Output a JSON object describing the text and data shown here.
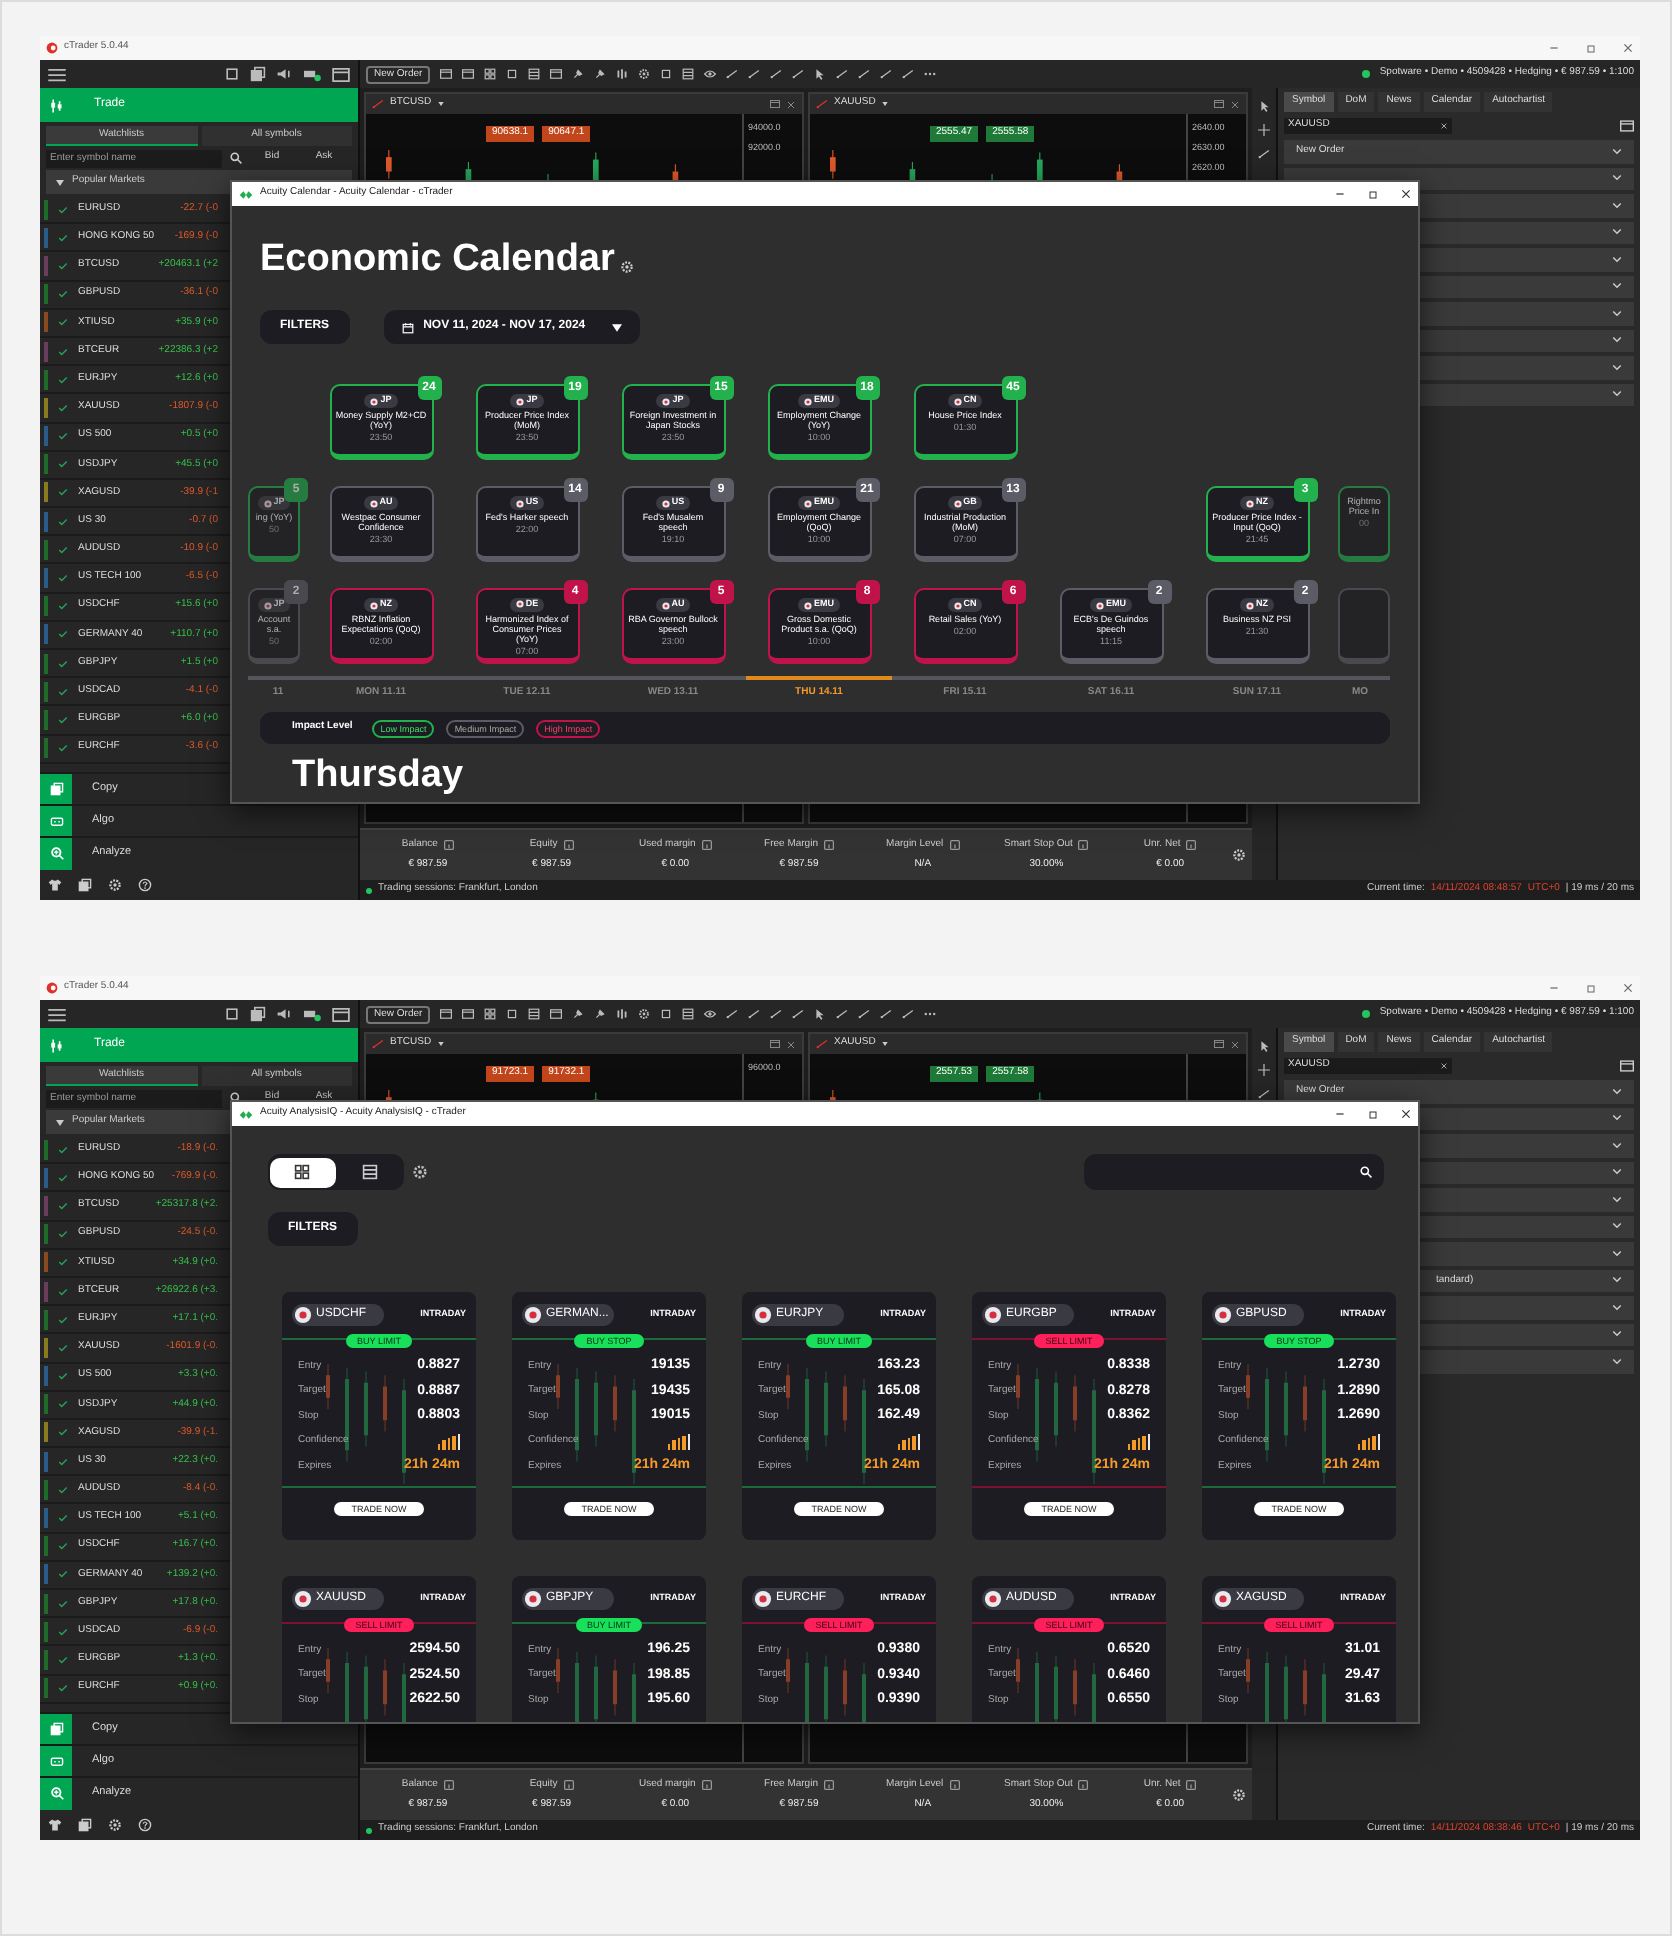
{
  "screenshots": [
    {
      "app_title": "cTrader 5.0.44",
      "trade_label": "Trade",
      "watchlist_tabs": [
        {
          "label": "Watchlists",
          "selected": true
        },
        {
          "label": "All symbols",
          "selected": false
        }
      ],
      "search": {
        "placeholder": "Enter symbol name"
      },
      "columns": [
        "Bid",
        "Ask"
      ],
      "group": "Popular Markets",
      "symbols": [
        {
          "name": "EURUSD",
          "change": "-22.7 (-0",
          "kind": "loss",
          "color": "#1f6b2a"
        },
        {
          "name": "HONG KONG 50",
          "change": "-169.9 (-0",
          "kind": "loss",
          "color": "#2a5c8a"
        },
        {
          "name": "BTCUSD",
          "change": "+20463.1 (+2",
          "kind": "gain",
          "color": "#6a3d5c"
        },
        {
          "name": "GBPUSD",
          "change": "-36.1 (-0",
          "kind": "loss",
          "color": "#1f6b2a"
        },
        {
          "name": "XTIUSD",
          "change": "+35.9 (+0",
          "kind": "gain",
          "color": "#8a4a1f"
        },
        {
          "name": "BTCEUR",
          "change": "+22386.3 (+2",
          "kind": "gain",
          "color": "#6a3d5c"
        },
        {
          "name": "EURJPY",
          "change": "+12.6 (+0",
          "kind": "gain",
          "color": "#1f6b2a"
        },
        {
          "name": "XAUUSD",
          "change": "-1807.9 (-0",
          "kind": "loss",
          "color": "#8a7a1f"
        },
        {
          "name": "US 500",
          "change": "+0.5 (+0",
          "kind": "gain",
          "color": "#2a5c8a"
        },
        {
          "name": "USDJPY",
          "change": "+45.5 (+0",
          "kind": "gain",
          "color": "#1f6b2a"
        },
        {
          "name": "XAGUSD",
          "change": "-39.9 (-1",
          "kind": "loss",
          "color": "#8a7a1f"
        },
        {
          "name": "US 30",
          "change": "-0.7 (0",
          "kind": "loss",
          "color": "#2a5c8a"
        },
        {
          "name": "AUDUSD",
          "change": "-10.9 (-0",
          "kind": "loss",
          "color": "#1f6b2a"
        },
        {
          "name": "US TECH 100",
          "change": "-6.5 (-0",
          "kind": "loss",
          "color": "#2a5c8a"
        },
        {
          "name": "USDCHF",
          "change": "+15.6 (+0",
          "kind": "gain",
          "color": "#1f6b2a"
        },
        {
          "name": "GERMANY 40",
          "change": "+110.7 (+0",
          "kind": "gain",
          "color": "#2a5c8a"
        },
        {
          "name": "GBPJPY",
          "change": "+1.5 (+0",
          "kind": "gain",
          "color": "#1f6b2a"
        },
        {
          "name": "USDCAD",
          "change": "-4.1 (-0",
          "kind": "loss",
          "color": "#1f6b2a"
        },
        {
          "name": "EURGBP",
          "change": "+6.0 (+0",
          "kind": "gain",
          "color": "#1f6b2a"
        },
        {
          "name": "EURCHF",
          "change": "-3.6 (-0",
          "kind": "loss",
          "color": "#1f6b2a"
        }
      ],
      "nav": [
        "Copy",
        "Algo",
        "Analyze"
      ],
      "toolbar": {
        "new_order": "New Order",
        "account": "Spotware • Demo • 4509428 • Hedging • € 987.59 • 1:100"
      },
      "charts": [
        {
          "symbol": "BTCUSD",
          "sell": "90638.1",
          "buy": "90647.1",
          "kind": "loss",
          "ticks": [
            "94000.0",
            "92000.0"
          ]
        },
        {
          "symbol": "XAUUSD",
          "sell": "2555.47",
          "buy": "2555.58",
          "kind": "gain",
          "ticks": [
            "2640.00",
            "2630.00",
            "2620.00"
          ]
        }
      ],
      "right_tabs": [
        {
          "label": "Symbol",
          "selected": true
        },
        {
          "label": "DoM",
          "selected": false
        },
        {
          "label": "News",
          "selected": false
        },
        {
          "label": "Calendar",
          "selected": false
        },
        {
          "label": "Autochartist",
          "selected": false
        }
      ],
      "right_symbol": "XAUUSD",
      "right_rows": [
        {
          "kind": "label",
          "label": "New Order"
        },
        {
          "kind": "blank"
        },
        {
          "kind": "blank"
        },
        {
          "kind": "blank"
        },
        {
          "kind": "blank"
        },
        {
          "kind": "blank"
        },
        {
          "kind": "blank"
        },
        {
          "kind": "blank"
        },
        {
          "kind": "blank"
        },
        {
          "kind": "blank"
        }
      ],
      "metrics": [
        {
          "label": "Balance",
          "value": "€ 987.59"
        },
        {
          "label": "Equity",
          "value": "€ 987.59"
        },
        {
          "label": "Used margin",
          "value": "€ 0.00"
        },
        {
          "label": "Free Margin",
          "value": "€ 987.59"
        },
        {
          "label": "Margin Level",
          "value": "N/A"
        },
        {
          "label": "Smart Stop Out",
          "value": "30.00%"
        },
        {
          "label": "Unr. Net",
          "value": "€ 0.00"
        }
      ],
      "status": {
        "sessions": "Trading sessions: Frankfurt, London",
        "time_label": "Current time:",
        "time": "14/11/2024 08:48:57",
        "timezone": "UTC+0",
        "latency": "| 19 ms / 20 ms"
      },
      "window": {
        "kind": "calendar",
        "title": "Acuity Calendar - Acuity Calendar - cTrader",
        "heading": "Economic Calendar",
        "filters": "FILTERS",
        "date_range": "NOV 11, 2024 - NOV 17, 2024",
        "days": [
          {
            "label": "11",
            "kind": "partial",
            "selected": false,
            "middle": {
              "country": "JP",
              "title": "ing (YoY)",
              "time": "50",
              "count": "5",
              "kind": "low"
            },
            "bottom": {
              "country": "JP",
              "title": "Account s.a.",
              "time": "50",
              "count": "2",
              "kind": "medium"
            }
          },
          {
            "label": "MON 11.11",
            "kind": "full",
            "selected": false,
            "top": {
              "country": "JP",
              "title": "Money Supply M2+CD (YoY)",
              "time": "23:50",
              "count": "24",
              "kind": "low"
            },
            "middle": {
              "country": "AU",
              "title": "Westpac Consumer Confidence",
              "time": "23:30",
              "kind": "medium"
            },
            "bottom": {
              "country": "NZ",
              "title": "RBNZ Inflation Expectations (QoQ)",
              "time": "02:00",
              "kind": "high"
            }
          },
          {
            "label": "TUE 12.11",
            "kind": "full",
            "selected": false,
            "top": {
              "country": "JP",
              "title": "Producer Price Index (MoM)",
              "time": "23:50",
              "count": "19",
              "kind": "low"
            },
            "middle": {
              "country": "US",
              "title": "Fed's Harker speech",
              "time": "22:00",
              "count": "14",
              "kind": "medium"
            },
            "bottom": {
              "country": "DE",
              "title": "Harmonized Index of Consumer Prices (YoY)",
              "time": "07:00",
              "count": "4",
              "kind": "high"
            }
          },
          {
            "label": "WED 13.11",
            "kind": "full",
            "selected": false,
            "top": {
              "country": "JP",
              "title": "Foreign Investment in Japan Stocks",
              "time": "23:50",
              "count": "15",
              "kind": "low"
            },
            "middle": {
              "country": "US",
              "title": "Fed's Musalem speech",
              "time": "19:10",
              "count": "9",
              "kind": "medium"
            },
            "bottom": {
              "country": "AU",
              "title": "RBA Governor Bullock speech",
              "time": "23:00",
              "count": "5",
              "kind": "high"
            }
          },
          {
            "label": "THU 14.11",
            "kind": "full",
            "selected": true,
            "top": {
              "country": "EMU",
              "title": "Employment Change (YoY)",
              "time": "10:00",
              "count": "18",
              "kind": "low"
            },
            "middle": {
              "country": "EMU",
              "title": "Employment Change (QoQ)",
              "time": "10:00",
              "count": "21",
              "kind": "medium"
            },
            "bottom": {
              "country": "EMU",
              "title": "Gross Domestic Product s.a. (QoQ)",
              "time": "10:00",
              "count": "8",
              "kind": "high"
            }
          },
          {
            "label": "FRI 15.11",
            "kind": "full",
            "selected": false,
            "top": {
              "country": "CN",
              "title": "House Price Index",
              "time": "01:30",
              "count": "45",
              "kind": "low"
            },
            "middle": {
              "country": "GB",
              "title": "Industrial Production (MoM)",
              "time": "07:00",
              "count": "13",
              "kind": "medium"
            },
            "bottom": {
              "country": "CN",
              "title": "Retail Sales (YoY)",
              "time": "02:00",
              "count": "6",
              "kind": "high"
            }
          },
          {
            "label": "SAT 16.11",
            "kind": "full",
            "selected": false,
            "bottom": {
              "country": "EMU",
              "title": "ECB's De Guindos speech",
              "time": "11:15",
              "count": "2",
              "kind": "medium"
            }
          },
          {
            "label": "SUN 17.11",
            "kind": "full",
            "selected": false,
            "middle": {
              "country": "NZ",
              "title": "Producer Price Index - Input (QoQ)",
              "time": "21:45",
              "count": "3",
              "kind": "low"
            },
            "bottom": {
              "country": "NZ",
              "title": "Business NZ PSI",
              "time": "21:30",
              "count": "2",
              "kind": "medium"
            }
          },
          {
            "label": "MO",
            "kind": "partial",
            "selected": false,
            "middle": {
              "title": "Rightmo Price In",
              "time": "00",
              "kind": "low"
            },
            "bottom": {
              "kind": "medium"
            }
          }
        ],
        "legend": {
          "label": "Impact Level",
          "items": [
            {
              "label": "Low Impact",
              "kind": "low"
            },
            {
              "label": "Medium Impact",
              "kind": "medium"
            },
            {
              "label": "High Impact",
              "kind": "high"
            }
          ]
        },
        "day_heading": "Thursday"
      }
    },
    {
      "app_title": "cTrader 5.0.44",
      "trade_label": "Trade",
      "watchlist_tabs": [
        {
          "label": "Watchlists",
          "selected": true
        },
        {
          "label": "All symbols",
          "selected": false
        }
      ],
      "search": {
        "placeholder": "Enter symbol name"
      },
      "columns": [
        "Bid",
        "Ask"
      ],
      "group": "Popular Markets",
      "symbols": [
        {
          "name": "EURUSD",
          "change": "-18.9 (-0.",
          "kind": "loss",
          "color": "#1f6b2a"
        },
        {
          "name": "HONG KONG 50",
          "change": "-769.9 (-0.",
          "kind": "loss",
          "color": "#2a5c8a"
        },
        {
          "name": "BTCUSD",
          "change": "+25317.8 (+2.",
          "kind": "gain",
          "color": "#6a3d5c"
        },
        {
          "name": "GBPUSD",
          "change": "-24.5 (-0.",
          "kind": "loss",
          "color": "#1f6b2a"
        },
        {
          "name": "XTIUSD",
          "change": "+34.9 (+0.",
          "kind": "gain",
          "color": "#8a4a1f"
        },
        {
          "name": "BTCEUR",
          "change": "+26922.6 (+3.",
          "kind": "gain",
          "color": "#6a3d5c"
        },
        {
          "name": "EURJPY",
          "change": "+17.1 (+0.",
          "kind": "gain",
          "color": "#1f6b2a"
        },
        {
          "name": "XAUUSD",
          "change": "-1601.9 (-0.",
          "kind": "loss",
          "color": "#8a7a1f"
        },
        {
          "name": "US 500",
          "change": "+3.3 (+0.",
          "kind": "gain",
          "color": "#2a5c8a"
        },
        {
          "name": "USDJPY",
          "change": "+44.9 (+0.",
          "kind": "gain",
          "color": "#1f6b2a"
        },
        {
          "name": "XAGUSD",
          "change": "-39.9 (-1.",
          "kind": "loss",
          "color": "#8a7a1f"
        },
        {
          "name": "US 30",
          "change": "+22.3 (+0.",
          "kind": "gain",
          "color": "#2a5c8a"
        },
        {
          "name": "AUDUSD",
          "change": "-8.4 (-0.",
          "kind": "loss",
          "color": "#1f6b2a"
        },
        {
          "name": "US TECH 100",
          "change": "+5.1 (+0.",
          "kind": "gain",
          "color": "#2a5c8a"
        },
        {
          "name": "USDCHF",
          "change": "+16.7 (+0.",
          "kind": "gain",
          "color": "#1f6b2a"
        },
        {
          "name": "GERMANY 40",
          "change": "+139.2 (+0.",
          "kind": "gain",
          "color": "#2a5c8a"
        },
        {
          "name": "GBPJPY",
          "change": "+17.8 (+0.",
          "kind": "gain",
          "color": "#1f6b2a"
        },
        {
          "name": "USDCAD",
          "change": "-6.9 (-0.",
          "kind": "loss",
          "color": "#1f6b2a"
        },
        {
          "name": "EURGBP",
          "change": "+1.3 (+0.",
          "kind": "gain",
          "color": "#1f6b2a"
        },
        {
          "name": "EURCHF",
          "change": "+0.9 (+0.",
          "kind": "gain",
          "color": "#1f6b2a"
        }
      ],
      "nav": [
        "Copy",
        "Algo",
        "Analyze"
      ],
      "toolbar": {
        "new_order": "New Order",
        "account": "Spotware • Demo • 4509428 • Hedging • € 987.59 • 1:100"
      },
      "charts": [
        {
          "symbol": "BTCUSD",
          "sell": "91723.1",
          "buy": "91732.1",
          "kind": "loss",
          "ticks": [
            "96000.0"
          ]
        },
        {
          "symbol": "XAUUSD",
          "sell": "2557.53",
          "buy": "2557.58",
          "kind": "gain"
        }
      ],
      "right_tabs": [
        {
          "label": "Symbol",
          "selected": true
        },
        {
          "label": "DoM",
          "selected": false
        },
        {
          "label": "News",
          "selected": false
        },
        {
          "label": "Calendar",
          "selected": false
        },
        {
          "label": "Autochartist",
          "selected": false
        }
      ],
      "right_symbol": "XAUUSD",
      "right_rows": [
        {
          "kind": "label",
          "label": "New Order"
        },
        {
          "kind": "blank"
        },
        {
          "kind": "blank"
        },
        {
          "kind": "blank"
        },
        {
          "kind": "blank"
        },
        {
          "kind": "blank"
        },
        {
          "kind": "blank"
        },
        {
          "kind": "tail",
          "label": "tandard)"
        },
        {
          "kind": "blank"
        },
        {
          "kind": "blank"
        },
        {
          "kind": "blank"
        }
      ],
      "metrics": [
        {
          "label": "Balance",
          "value": "€ 987.59"
        },
        {
          "label": "Equity",
          "value": "€ 987.59"
        },
        {
          "label": "Used margin",
          "value": "€ 0.00"
        },
        {
          "label": "Free Margin",
          "value": "€ 987.59"
        },
        {
          "label": "Margin Level",
          "value": "N/A"
        },
        {
          "label": "Smart Stop Out",
          "value": "30.00%"
        },
        {
          "label": "Unr. Net",
          "value": "€ 0.00"
        }
      ],
      "status": {
        "sessions": "Trading sessions: Frankfurt, London",
        "time_label": "Current time:",
        "time": "14/11/2024 08:38:46",
        "timezone": "UTC+0",
        "latency": "| 19 ms / 20 ms"
      },
      "window": {
        "kind": "analysis",
        "title": "Acuity AnalysisIQ - Acuity AnalysisIQ - cTrader",
        "views": [
          {
            "kind": "grid",
            "selected": true
          },
          {
            "kind": "list",
            "selected": false
          }
        ],
        "filters": "FILTERS",
        "cards": [
          {
            "symbol": "USDCHF",
            "timeframe": "INTRADAY",
            "signal": "BUY LIMIT",
            "kind": "buy",
            "rows": [
              {
                "label": "Entry",
                "value": "0.8827"
              },
              {
                "label": "Target",
                "value": "0.8887"
              },
              {
                "label": "Stop",
                "value": "0.8803"
              }
            ],
            "confidence": {
              "label": "Confidence",
              "level": 0.8
            },
            "expires": {
              "label": "Expires",
              "value": "21h 24m"
            },
            "button": "TRADE NOW"
          },
          {
            "symbol": "GERMAN...",
            "timeframe": "INTRADAY",
            "signal": "BUY STOP",
            "kind": "buy",
            "rows": [
              {
                "label": "Entry",
                "value": "19135"
              },
              {
                "label": "Target",
                "value": "19435"
              },
              {
                "label": "Stop",
                "value": "19015"
              }
            ],
            "confidence": {
              "label": "Confidence",
              "level": 0.8
            },
            "expires": {
              "label": "Expires",
              "value": "21h 24m"
            },
            "button": "TRADE NOW"
          },
          {
            "symbol": "EURJPY",
            "timeframe": "INTRADAY",
            "signal": "BUY LIMIT",
            "kind": "buy",
            "rows": [
              {
                "label": "Entry",
                "value": "163.23"
              },
              {
                "label": "Target",
                "value": "165.08"
              },
              {
                "label": "Stop",
                "value": "162.49"
              }
            ],
            "confidence": {
              "label": "Confidence",
              "level": 0.8
            },
            "expires": {
              "label": "Expires",
              "value": "21h 24m"
            },
            "button": "TRADE NOW"
          },
          {
            "symbol": "EURGBP",
            "timeframe": "INTRADAY",
            "signal": "SELL LIMIT",
            "kind": "sell",
            "rows": [
              {
                "label": "Entry",
                "value": "0.8338"
              },
              {
                "label": "Target",
                "value": "0.8278"
              },
              {
                "label": "Stop",
                "value": "0.8362"
              }
            ],
            "confidence": {
              "label": "Confidence",
              "level": 0.8
            },
            "expires": {
              "label": "Expires",
              "value": "21h 24m"
            },
            "button": "TRADE NOW"
          },
          {
            "symbol": "GBPUSD",
            "timeframe": "INTRADAY",
            "signal": "BUY STOP",
            "kind": "buy",
            "rows": [
              {
                "label": "Entry",
                "value": "1.2730"
              },
              {
                "label": "Target",
                "value": "1.2890"
              },
              {
                "label": "Stop",
                "value": "1.2690"
              }
            ],
            "confidence": {
              "label": "Confidence",
              "level": 0.8
            },
            "expires": {
              "label": "Expires",
              "value": "21h 24m"
            },
            "button": "TRADE NOW"
          },
          {
            "symbol": "XAUUSD",
            "timeframe": "INTRADAY",
            "signal": "SELL LIMIT",
            "kind": "sell",
            "rows": [
              {
                "label": "Entry",
                "value": "2594.50"
              },
              {
                "label": "Target",
                "value": "2524.50"
              },
              {
                "label": "Stop",
                "value": "2622.50"
              }
            ]
          },
          {
            "symbol": "GBPJPY",
            "timeframe": "INTRADAY",
            "signal": "BUY LIMIT",
            "kind": "buy",
            "rows": [
              {
                "label": "Entry",
                "value": "196.25"
              },
              {
                "label": "Target",
                "value": "198.85"
              },
              {
                "label": "Stop",
                "value": "195.60"
              }
            ]
          },
          {
            "symbol": "EURCHF",
            "timeframe": "INTRADAY",
            "signal": "SELL LIMIT",
            "kind": "sell",
            "rows": [
              {
                "label": "Entry",
                "value": "0.9380"
              },
              {
                "label": "Target",
                "value": "0.9340"
              },
              {
                "label": "Stop",
                "value": "0.9390"
              }
            ]
          },
          {
            "symbol": "AUDUSD",
            "timeframe": "INTRADAY",
            "signal": "SELL LIMIT",
            "kind": "sell",
            "rows": [
              {
                "label": "Entry",
                "value": "0.6520"
              },
              {
                "label": "Target",
                "value": "0.6460"
              },
              {
                "label": "Stop",
                "value": "0.6550"
              }
            ]
          },
          {
            "symbol": "XAGUSD",
            "timeframe": "INTRADAY",
            "signal": "SELL LIMIT",
            "kind": "sell",
            "rows": [
              {
                "label": "Entry",
                "value": "31.01"
              },
              {
                "label": "Target",
                "value": "29.47"
              },
              {
                "label": "Stop",
                "value": "31.63"
              }
            ]
          }
        ]
      }
    }
  ]
}
